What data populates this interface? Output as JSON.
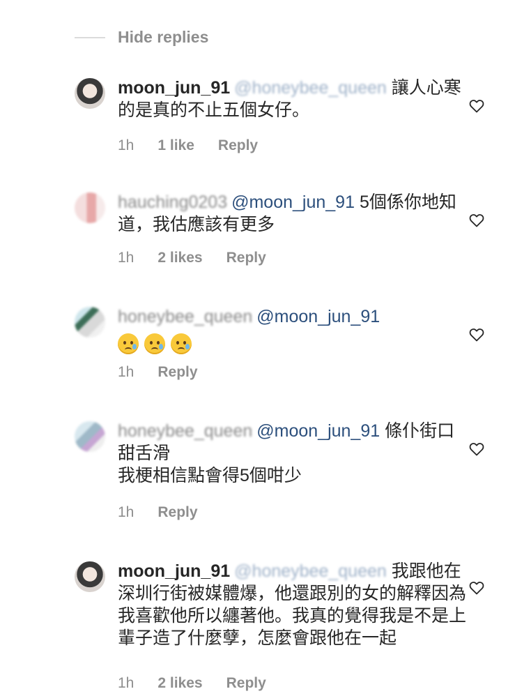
{
  "hide_replies": {
    "label": "Hide replies"
  },
  "comments": [
    {
      "username": "moon_jun_91",
      "mention": "@honeybee_queen",
      "body": "讓人心寒的是真的不止五個女仔。",
      "time": "1h",
      "likes": "1 like",
      "reply": "Reply"
    },
    {
      "username": "hauching0203",
      "mention": "@moon_jun_91",
      "body": "5個係你地知道，我估應該有更多",
      "time": "1h",
      "likes": "2 likes",
      "reply": "Reply"
    },
    {
      "username": "honeybee_queen",
      "mention": "@moon_jun_91",
      "body": "",
      "emojis": [
        "crying-face",
        "crying-face",
        "crying-face"
      ],
      "time": "1h",
      "reply": "Reply"
    },
    {
      "username": "honeybee_queen",
      "mention": "@moon_jun_91",
      "body": "條仆街口甜舌滑",
      "body_line2": "我梗相信點會得5個咁少",
      "time": "1h",
      "reply": "Reply"
    },
    {
      "username": "moon_jun_91",
      "mention": "@honeybee_queen",
      "body": "我跟他在深圳行街被媒體爆，他還跟別的女的解釋因為我喜歡他所以纏著他。我真的覺得我是不是上輩子造了什麼孽，怎麼會跟他在一起",
      "time": "1h",
      "likes": "2 likes",
      "reply": "Reply"
    }
  ],
  "colors": {
    "text": "#262626",
    "mention": "#2c4f7c",
    "meta": "#8e8e8e",
    "divider": "#dbdbdb"
  },
  "icons": {
    "like": "heart-outline-icon"
  }
}
